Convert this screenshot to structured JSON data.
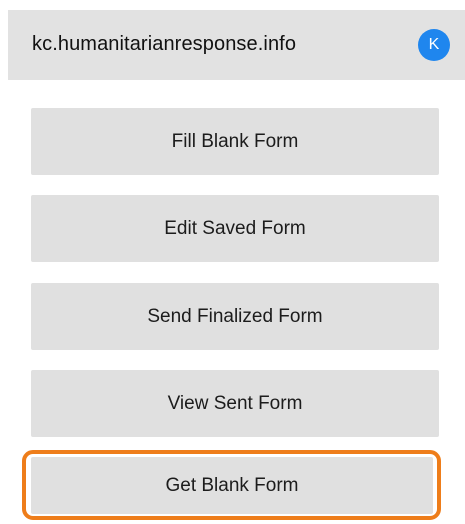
{
  "server": {
    "name": "kc.humanitarianresponse.info",
    "avatar_initial": "K",
    "avatar_color": "#1f86ee"
  },
  "menu": {
    "fill_blank_form": "Fill Blank Form",
    "edit_saved_form": "Edit Saved Form",
    "send_finalized_form": "Send Finalized Form",
    "view_sent_form": "View Sent Form",
    "get_blank_form": "Get Blank Form"
  },
  "highlight": {
    "target": "get_blank_form",
    "color": "#ee7d1a"
  }
}
